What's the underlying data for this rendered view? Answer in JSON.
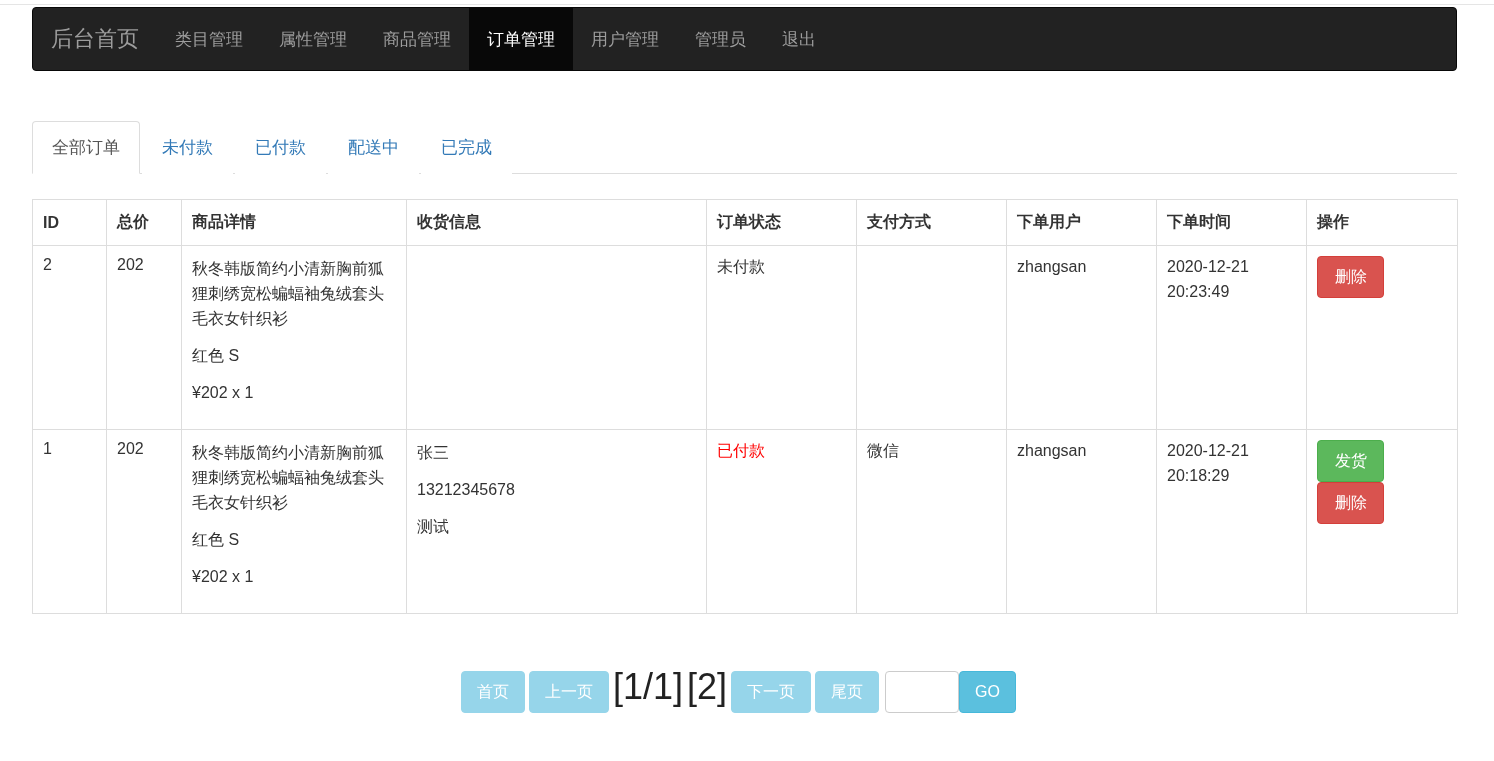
{
  "navbar": {
    "brand": "后台首页",
    "items": [
      {
        "label": "类目管理",
        "selected": false
      },
      {
        "label": "属性管理",
        "selected": false
      },
      {
        "label": "商品管理",
        "selected": false
      },
      {
        "label": "订单管理",
        "selected": true
      },
      {
        "label": "用户管理",
        "selected": false
      },
      {
        "label": "管理员",
        "selected": false
      },
      {
        "label": "退出",
        "selected": false
      }
    ]
  },
  "tabs": [
    {
      "label": "全部订单",
      "selected": true
    },
    {
      "label": "未付款",
      "selected": false
    },
    {
      "label": "已付款",
      "selected": false
    },
    {
      "label": "配送中",
      "selected": false
    },
    {
      "label": "已完成",
      "selected": false
    }
  ],
  "table": {
    "columns": [
      "ID",
      "总价",
      "商品详情",
      "收货信息",
      "订单状态",
      "支付方式",
      "下单用户",
      "下单时间",
      "操作"
    ],
    "rows": [
      {
        "id": "2",
        "total": "202",
        "product": {
          "name": "秋冬韩版简约小清新胸前狐狸刺绣宽松蝙蝠袖兔绒套头毛衣女针织衫",
          "spec": "红色 S",
          "price": "¥202 x 1"
        },
        "shipping": [],
        "status": {
          "text": "未付款",
          "color": "#333333"
        },
        "payment": "",
        "user": "zhangsan",
        "time": [
          "2020-12-21",
          "20:23:49"
        ],
        "actions": [
          {
            "kind": "delete",
            "label": "删除"
          }
        ]
      },
      {
        "id": "1",
        "total": "202",
        "product": {
          "name": "秋冬韩版简约小清新胸前狐狸刺绣宽松蝙蝠袖兔绒套头毛衣女针织衫",
          "spec": "红色 S",
          "price": "¥202 x 1"
        },
        "shipping": [
          "张三",
          "13212345678",
          "测试"
        ],
        "status": {
          "text": "已付款",
          "color": "#ff0000"
        },
        "payment": "微信",
        "user": "zhangsan",
        "time": [
          "2020-12-21",
          "20:18:29"
        ],
        "actions": [
          {
            "kind": "ship",
            "label": "发货"
          },
          {
            "kind": "delete",
            "label": "删除"
          }
        ]
      }
    ]
  },
  "pagination": {
    "first": {
      "label": "首页",
      "disabled": true
    },
    "prev": {
      "label": "上一页",
      "disabled": true
    },
    "page_info": "[1/1]",
    "total": "[2]",
    "next": {
      "label": "下一页",
      "disabled": true
    },
    "last": {
      "label": "尾页",
      "disabled": true
    },
    "go": {
      "label": "GO",
      "disabled": false
    }
  }
}
